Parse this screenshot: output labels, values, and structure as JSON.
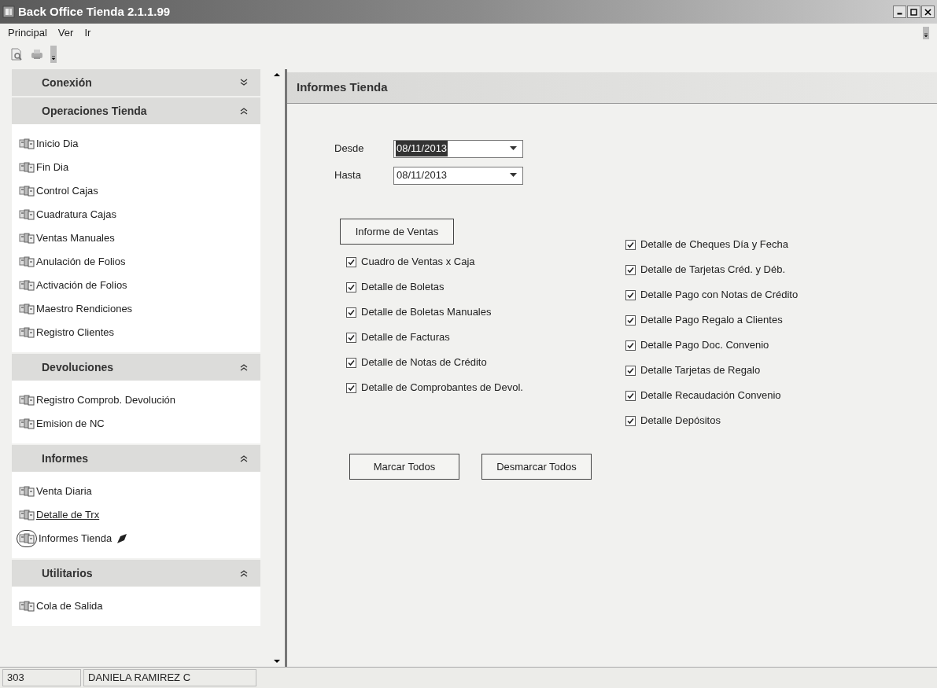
{
  "window": {
    "title": "Back Office Tienda 2.1.1.99"
  },
  "menu": [
    "Principal",
    "Ver",
    "Ir"
  ],
  "sidebar": {
    "sections": [
      {
        "title": "Conexión",
        "expanded": false
      },
      {
        "title": "Operaciones Tienda",
        "expanded": true,
        "items": [
          {
            "label": "Inicio Dia",
            "selected": false,
            "hovered": false
          },
          {
            "label": "Fin Dia",
            "selected": false,
            "hovered": false
          },
          {
            "label": "Control Cajas",
            "selected": false,
            "hovered": false
          },
          {
            "label": "Cuadratura Cajas",
            "selected": false,
            "hovered": false
          },
          {
            "label": "Ventas Manuales",
            "selected": false,
            "hovered": false
          },
          {
            "label": "Anulación de Folios",
            "selected": false,
            "hovered": false
          },
          {
            "label": "Activación de Folios",
            "selected": false,
            "hovered": false
          },
          {
            "label": "Maestro Rendiciones",
            "selected": false,
            "hovered": false
          },
          {
            "label": "Registro Clientes",
            "selected": false,
            "hovered": false
          }
        ]
      },
      {
        "title": "Devoluciones",
        "expanded": true,
        "items": [
          {
            "label": "Registro Comprob. Devolución",
            "selected": false,
            "hovered": false
          },
          {
            "label": "Emision de NC",
            "selected": false,
            "hovered": false
          }
        ]
      },
      {
        "title": "Informes",
        "expanded": true,
        "items": [
          {
            "label": "Venta Diaria",
            "selected": false,
            "hovered": false
          },
          {
            "label": "Detalle de Trx",
            "selected": false,
            "hovered": true
          },
          {
            "label": "Informes Tienda",
            "selected": true,
            "hovered": false
          }
        ]
      },
      {
        "title": "Utilitarios",
        "expanded": true,
        "items": [
          {
            "label": "Cola de Salida",
            "selected": false,
            "hovered": false
          }
        ]
      }
    ]
  },
  "panel": {
    "title": "Informes Tienda",
    "dates": [
      {
        "label": "Desde",
        "value": "08/11/2013",
        "focused": true
      },
      {
        "label": "Hasta",
        "value": "08/11/2013",
        "focused": false
      }
    ],
    "report_button": "Informe de Ventas",
    "options_left": [
      {
        "label": "Cuadro de Ventas x Caja",
        "checked": true
      },
      {
        "label": "Detalle de Boletas",
        "checked": true
      },
      {
        "label": "Detalle de Boletas Manuales",
        "checked": true
      },
      {
        "label": "Detalle de Facturas",
        "checked": true
      },
      {
        "label": "Detalle de Notas de Crédito",
        "checked": true
      },
      {
        "label": "Detalle de Comprobantes de Devol.",
        "checked": true
      }
    ],
    "options_right": [
      {
        "label": "Detalle de Cheques Día y Fecha",
        "checked": true
      },
      {
        "label": "Detalle de Tarjetas Créd. y Déb.",
        "checked": true
      },
      {
        "label": "Detalle Pago con Notas de Crédito",
        "checked": true
      },
      {
        "label": "Detalle Pago Regalo a Clientes",
        "checked": true
      },
      {
        "label": "Detalle Pago Doc. Convenio",
        "checked": true
      },
      {
        "label": "Detalle Tarjetas de Regalo",
        "checked": true
      },
      {
        "label": "Detalle Recaudación Convenio",
        "checked": true
      },
      {
        "label": "Detalle Depósitos",
        "checked": true
      }
    ],
    "buttons": [
      "Marcar Todos",
      "Desmarcar Todos"
    ]
  },
  "status_bar": [
    "303",
    "DANIELA RAMIREZ C"
  ]
}
